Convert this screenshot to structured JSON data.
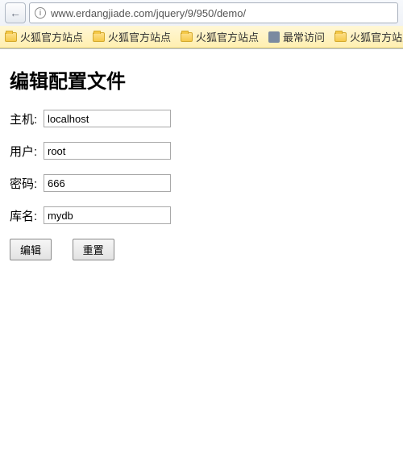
{
  "browser": {
    "url": "www.erdangjiade.com/jquery/9/950/demo/",
    "back_glyph": "←",
    "info_glyph": "i",
    "bookmarks": [
      {
        "label": "火狐官方站点",
        "icon": "folder"
      },
      {
        "label": "火狐官方站点",
        "icon": "folder"
      },
      {
        "label": "火狐官方站点",
        "icon": "folder"
      },
      {
        "label": "最常访问",
        "icon": "gear"
      },
      {
        "label": "火狐官方站点",
        "icon": "folder"
      },
      {
        "label": "",
        "icon": "globe"
      }
    ]
  },
  "page": {
    "title": "编辑配置文件",
    "fields": {
      "host": {
        "label": "主机:",
        "value": "localhost"
      },
      "user": {
        "label": "用户:",
        "value": "root"
      },
      "pass": {
        "label": "密码:",
        "value": "666"
      },
      "dbname": {
        "label": "库名:",
        "value": "mydb"
      }
    },
    "buttons": {
      "edit": "编辑",
      "reset": "重置"
    }
  }
}
